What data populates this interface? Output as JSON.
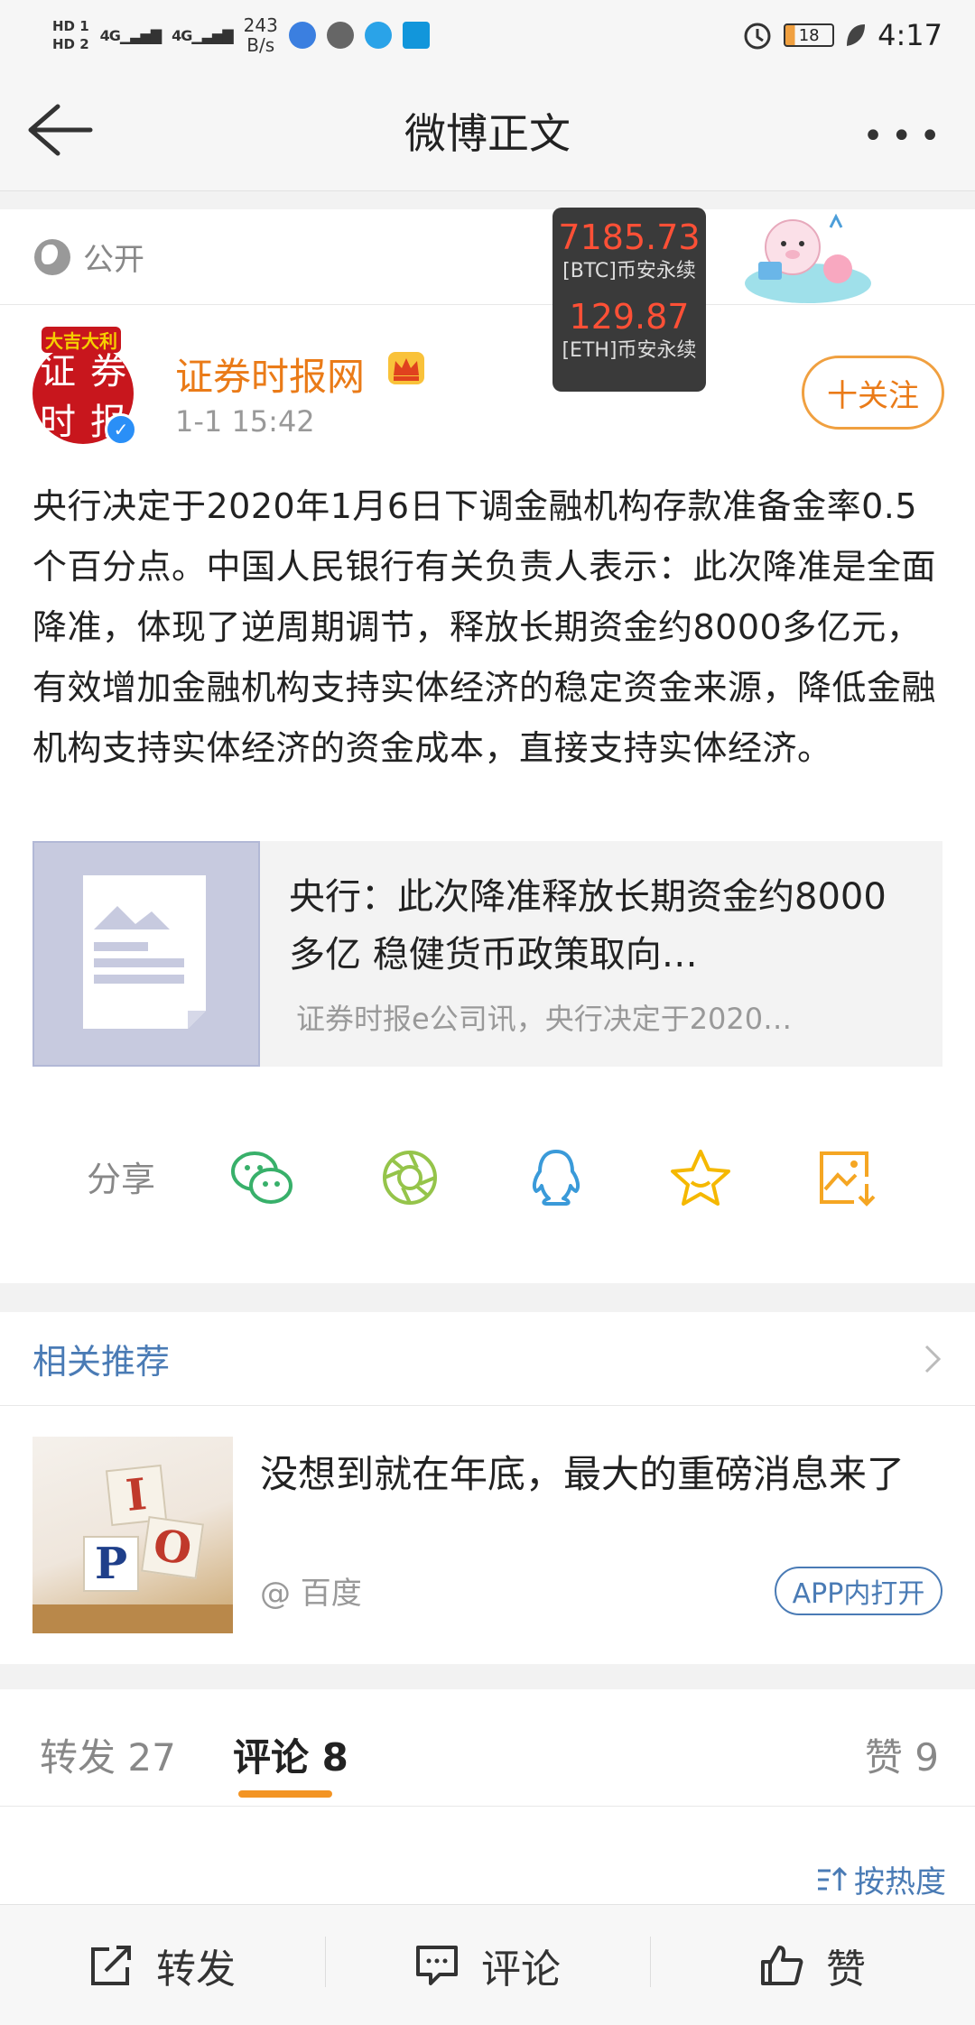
{
  "status_bar": {
    "hd1": "HD 1",
    "hd2": "HD 2",
    "net1": "4G",
    "net2": "4G",
    "speed_value": "243",
    "speed_unit": "B/s",
    "battery": "18",
    "time": "4:17"
  },
  "header": {
    "title": "微博正文"
  },
  "post": {
    "visibility": "公开",
    "author_name": "证券时报网",
    "timestamp": "1-1 15:42",
    "follow_label": "十关注",
    "avatar_chars": [
      "证",
      "券",
      "时",
      "报"
    ],
    "avatar_banner": "大吉大利",
    "text": "央行决定于2020年1月6日下调金融机构存款准备金率0.5个百分点。中国人民银行有关负责人表示：此次降准是全面降准，体现了逆周期调节，释放长期资金约8000多亿元，有效增加金融机构支持实体经济的稳定资金来源，降低金融机构支持实体经济的资金成本，直接支持实体经济。",
    "link_card": {
      "title": "央行：此次降准释放长期资金约8000多亿 稳健货币政策取向…",
      "summary": "证券时报e公司讯，央行决定于2020…"
    },
    "share_label": "分享"
  },
  "ticker": {
    "btc_price": "7185.73",
    "btc_label": "[BTC]币安永续",
    "eth_price": "129.87",
    "eth_label": "[ETH]币安永续"
  },
  "recommend": {
    "title": "相关推荐",
    "item": {
      "text": "没想到就在年底，最大的重磅消息来了",
      "source": "@ 百度",
      "open_label": "APP内打开",
      "blocks": [
        "I",
        "P",
        "O"
      ]
    }
  },
  "tabs": {
    "repost": "转发 27",
    "comment": "评论 8",
    "like": "赞 9",
    "sort": "按热度"
  },
  "bottom_bar": {
    "repost": "转发",
    "comment": "评论",
    "like": "赞"
  },
  "colors": {
    "accent_orange": "#ea7b18",
    "link_blue": "#4a7bb5",
    "ticker_red": "#ff5036"
  }
}
